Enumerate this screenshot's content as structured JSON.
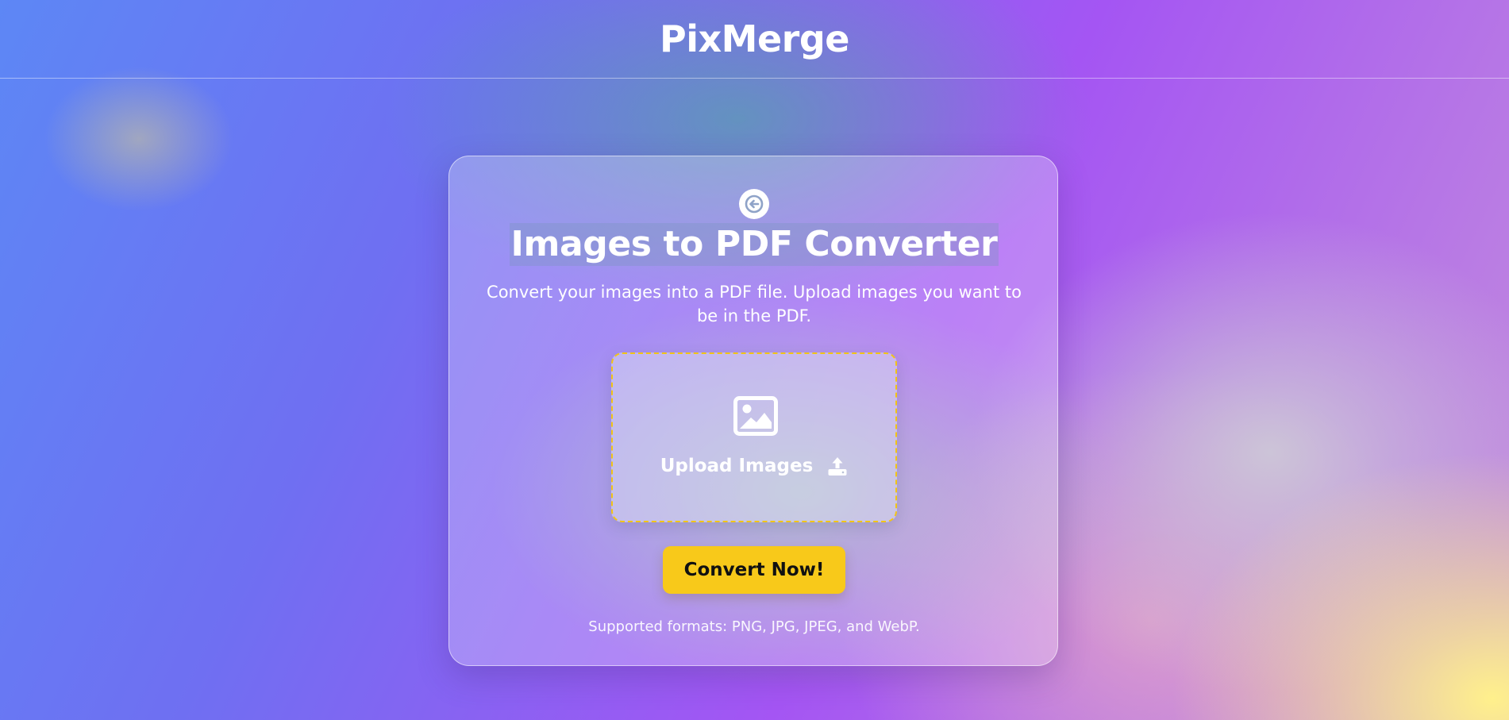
{
  "header": {
    "app_title": "PixMerge"
  },
  "card": {
    "back_icon": "arrow-left-icon",
    "title": "Images to PDF Converter",
    "description": "Convert your images into a PDF file. Upload images you want to be in the PDF.",
    "upload": {
      "label": "Upload Images",
      "image_icon": "image-icon",
      "upload_icon": "upload-icon",
      "border_color": "#f2c514"
    },
    "convert_button_label": "Convert Now!",
    "convert_button_color": "#f8c91a",
    "formats_note": "Supported formats: PNG, JPG, JPEG, and WebP."
  }
}
